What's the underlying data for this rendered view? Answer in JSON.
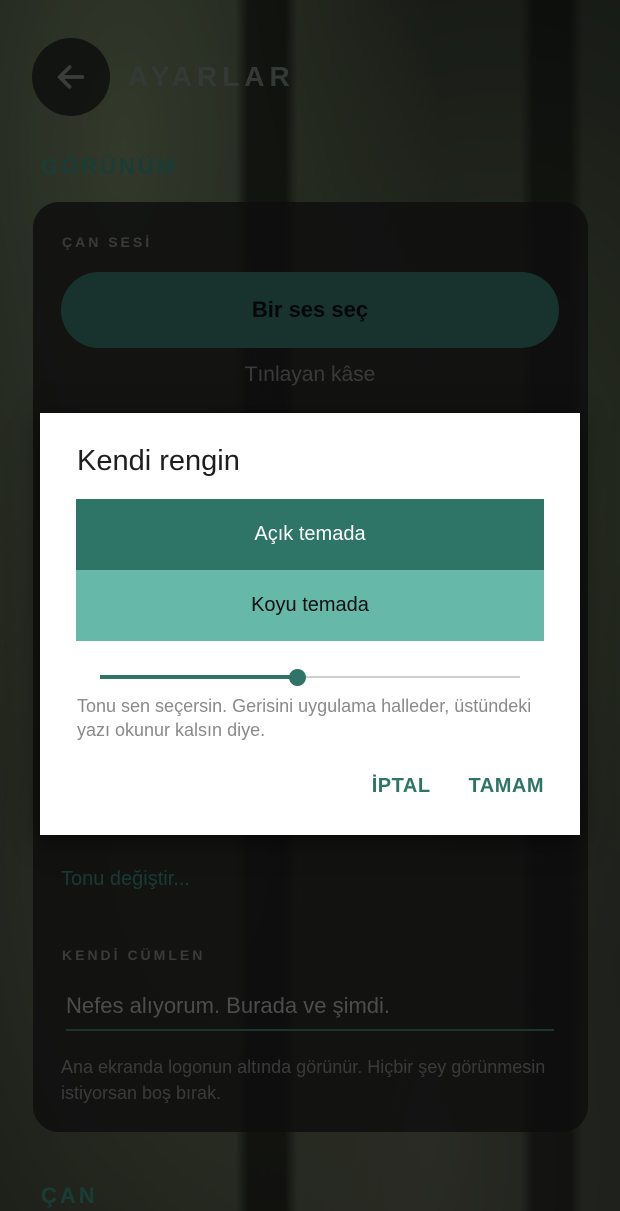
{
  "colors": {
    "accent": "#2f7567",
    "accent_light": "#66b8a8",
    "surface": "#ffffff"
  },
  "header": {
    "title": "AYARLAR",
    "back_icon": "arrow-left-icon"
  },
  "sections": {
    "appearance": "GÖRÜNÜM",
    "bell": "ÇAN"
  },
  "bell_sound": {
    "label": "ÇAN SESİ",
    "button": "Bir ses seç",
    "current": "Tınlayan kâse"
  },
  "tone": {
    "change_link": "Tonu değiştir..."
  },
  "custom_phrase": {
    "label": "KENDİ CÜMLEN",
    "value": "Nefes alıyorum. Burada ve şimdi.",
    "help": "Ana ekranda logonun altında görünür. Hiçbir şey görünmesin istiyorsan boş bırak."
  },
  "dialog": {
    "title": "Kendi rengin",
    "light_theme": "Açık temada",
    "dark_theme": "Koyu temada",
    "hue_level": 0.47,
    "help": "Tonu sen seçersin. Gerisini uygulama halleder, üstündeki yazı okunur kalsın diye.",
    "cancel": "İPTAL",
    "ok": "TAMAM"
  }
}
